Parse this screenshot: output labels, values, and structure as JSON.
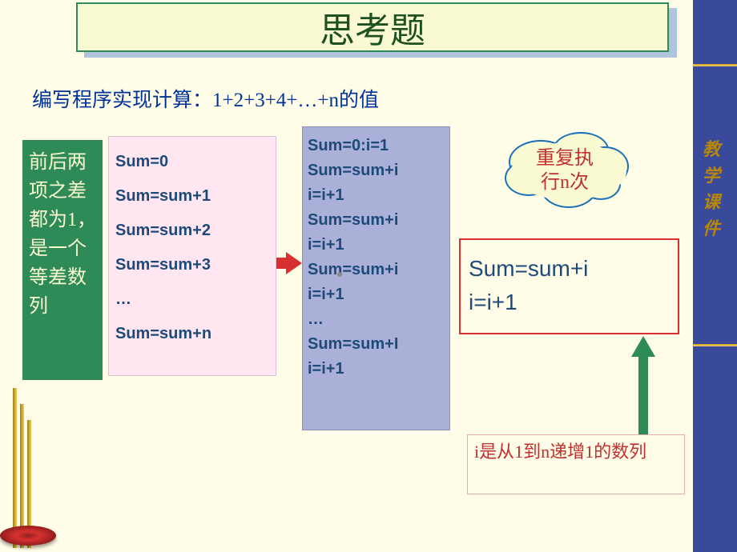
{
  "title": "思考题",
  "subtitle": "编写程序实现计算：1+2+3+4+…+n的值",
  "right_sidebar": "教学课件",
  "green_note": "前后两项之差都为1，是一个等差数列",
  "pink_code": {
    "l1": "Sum=0",
    "l2": "Sum=sum+1",
    "l3": "Sum=sum+2",
    "l4": "Sum=sum+3",
    "l5": "…",
    "l6": "Sum=sum+n"
  },
  "blue_code": {
    "l1": "Sum=0:i=1",
    "l2": "Sum=sum+i",
    "l3": "i=i+1",
    "l4": "Sum=sum+i",
    "l5": "i=i+1",
    "l6": "Sum=sum+i",
    "l7": "i=i+1",
    "l8": "…",
    "l9": "Sum=sum+I",
    "l10": "i=i+1"
  },
  "cloud_text": "重复执\n行n次",
  "red_box": {
    "l1": "Sum=sum+i",
    "l2": " i=i+1"
  },
  "bottom_note": "i是从1到n递增1的数列"
}
